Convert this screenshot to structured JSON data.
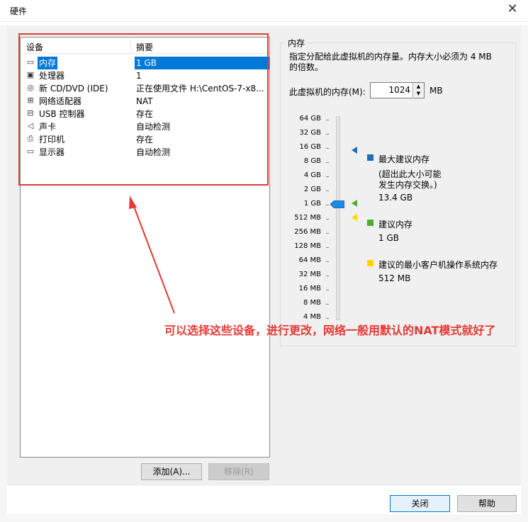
{
  "window": {
    "title": "硬件",
    "close_glyph": "✕"
  },
  "devices": {
    "col_device": "设备",
    "col_summary": "摘要",
    "items": [
      {
        "name": "内存",
        "summary": "1 GB",
        "icon": "memory-icon",
        "glyph": "▭"
      },
      {
        "name": "处理器",
        "summary": "1",
        "icon": "processor-icon",
        "glyph": "▣"
      },
      {
        "name": "新 CD/DVD (IDE)",
        "summary": "正在使用文件 H:\\CentOS-7-x8...",
        "icon": "cd-dvd-icon",
        "glyph": "◎"
      },
      {
        "name": "网络适配器",
        "summary": "NAT",
        "icon": "network-adapter-icon",
        "glyph": "⊞"
      },
      {
        "name": "USB 控制器",
        "summary": "存在",
        "icon": "usb-icon",
        "glyph": "⊟"
      },
      {
        "name": "声卡",
        "summary": "自动检测",
        "icon": "sound-card-icon",
        "glyph": "◁"
      },
      {
        "name": "打印机",
        "summary": "存在",
        "icon": "printer-icon",
        "glyph": "⎙"
      },
      {
        "name": "显示器",
        "summary": "自动检测",
        "icon": "monitor-icon",
        "glyph": "▭"
      }
    ],
    "add_button": "添加(A)...",
    "remove_button": "移除(R)"
  },
  "memory": {
    "group_title": "内存",
    "description": "指定分配给此虚拟机的内存量。内存大小必须为 4 MB 的倍数。",
    "label": "此虚拟机的内存(M):",
    "value": "1024",
    "unit": "MB",
    "scale": [
      "64 GB",
      "32 GB",
      "16 GB",
      "8 GB",
      "4 GB",
      "2 GB",
      "1 GB",
      "512 MB",
      "256 MB",
      "128 MB",
      "64 MB",
      "32 MB",
      "16 MB",
      "8 MB",
      "4 MB"
    ],
    "slider_value": "1 GB",
    "legend": {
      "max_title": "最大建议内存",
      "max_note_1": "(超出此大小可能",
      "max_note_2": "发生内存交换。)",
      "max_value": "13.4 GB",
      "rec_title": "建议内存",
      "rec_value": "1 GB",
      "min_title": "建议的最小客户机操作系统内存",
      "min_value": "512 MB"
    },
    "colors": {
      "max": "#1e6fb5",
      "rec": "#4caf2e",
      "min": "#ffd500",
      "thumb": "#1e88e5"
    }
  },
  "annotation": {
    "text": "可以选择这些设备，进行更改，网络一般用默认的NAT模式就好了",
    "color": "#e53935"
  },
  "footer": {
    "close_button": "关闭",
    "help_button": "帮助"
  }
}
